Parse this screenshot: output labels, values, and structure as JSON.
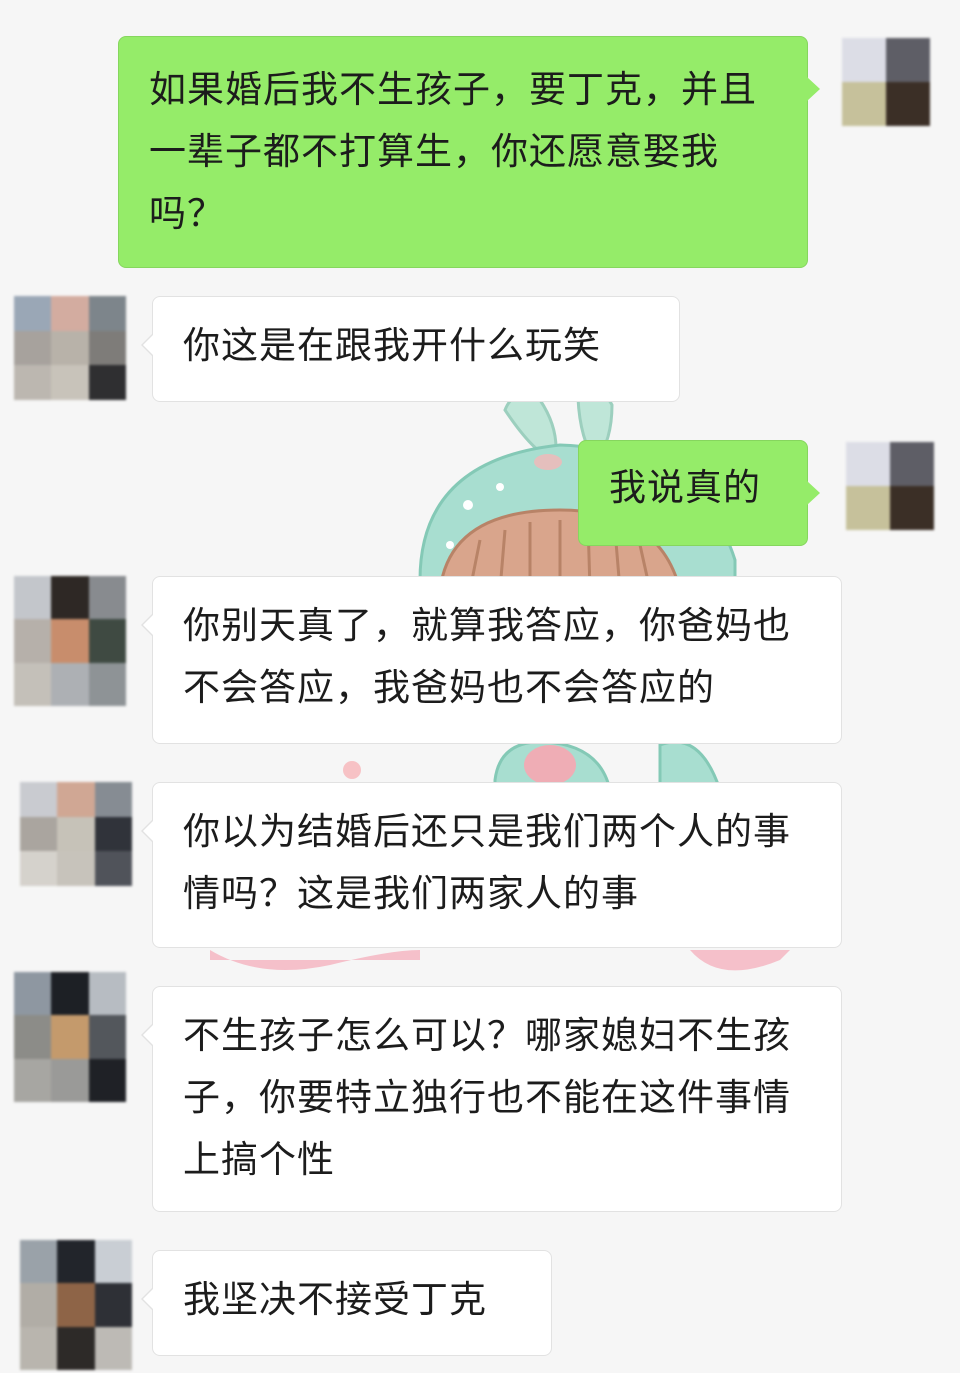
{
  "colors": {
    "outgoing_bubble": "#95ec69",
    "incoming_bubble": "#ffffff",
    "background": "#f6f6f6"
  },
  "messages": [
    {
      "sender": "self",
      "text": "如果婚后我不生孩子，要丁克，并且一辈子都不打算生，你还愿意娶我吗？"
    },
    {
      "sender": "other",
      "text": "你这是在跟我开什么玩笑"
    },
    {
      "sender": "self",
      "text": "我说真的"
    },
    {
      "sender": "other",
      "text": "你别天真了，就算我答应，你爸妈也不会答应，我爸妈也不会答应的"
    },
    {
      "sender": "other",
      "text": "你以为结婚后还只是我们两个人的事情吗？这是我们两家人的事"
    },
    {
      "sender": "other",
      "text": "不生孩子怎么可以？哪家媳妇不生孩子，你要特立独行也不能在这件事情上搞个性"
    },
    {
      "sender": "other",
      "text": "我坚决不接受丁克"
    }
  ]
}
